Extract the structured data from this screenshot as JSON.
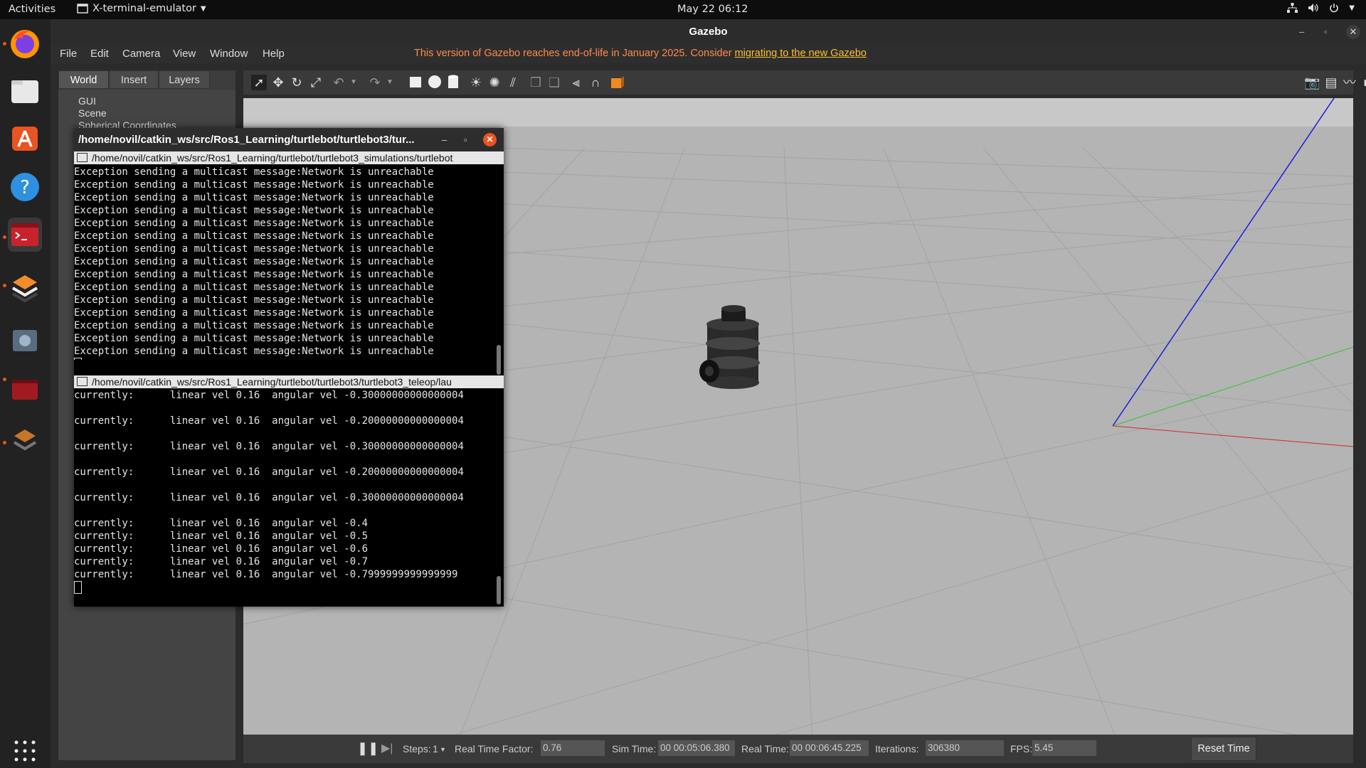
{
  "topbar": {
    "activities": "Activities",
    "app_name": "X-terminal-emulator",
    "clock": "May 22  06:12"
  },
  "dock": {
    "items": [
      "firefox-icon",
      "files-icon",
      "software-icon",
      "help-icon",
      "terminal-icon",
      "layers-icon",
      "grid-icon",
      "terminal-icon",
      "layers-icon"
    ],
    "show_apps": "apps-grid-icon"
  },
  "gazebo": {
    "title": "Gazebo",
    "menu": [
      "File",
      "Edit",
      "Camera",
      "View",
      "Window",
      "Help"
    ],
    "eol_text": "This version of Gazebo reaches end-of-life in January 2025. Consider ",
    "eol_link": "migrating to the new Gazebo",
    "tabs": [
      "World",
      "Insert",
      "Layers"
    ],
    "tree": [
      "GUI",
      "Scene",
      "Spherical Coordinates"
    ],
    "status": {
      "steps_label": "Steps:",
      "steps_value": "1",
      "rtf_label": "Real Time Factor:",
      "rtf_value": "0.76",
      "sim_label": "Sim Time:",
      "sim_value": "00 00:05:06.380",
      "real_label": "Real Time:",
      "real_value": "00 00:06:45.225",
      "iter_label": "Iterations:",
      "iter_value": "306380",
      "fps_label": "FPS:",
      "fps_value": "5.45",
      "reset_label": "Reset Time"
    }
  },
  "terminal": {
    "title": "/home/novil/catkin_ws/src/Ros1_Learning/turtlebot/turtlebot3/tur...",
    "pane1_path": "/home/novil/catkin_ws/src/Ros1_Learning/turtlebot/turtlebot3_simulations/turtlebot",
    "pane1_lines": [
      "Exception sending a multicast message:Network is unreachable",
      "Exception sending a multicast message:Network is unreachable",
      "Exception sending a multicast message:Network is unreachable",
      "Exception sending a multicast message:Network is unreachable",
      "Exception sending a multicast message:Network is unreachable",
      "Exception sending a multicast message:Network is unreachable",
      "Exception sending a multicast message:Network is unreachable",
      "Exception sending a multicast message:Network is unreachable",
      "Exception sending a multicast message:Network is unreachable",
      "Exception sending a multicast message:Network is unreachable",
      "Exception sending a multicast message:Network is unreachable",
      "Exception sending a multicast message:Network is unreachable",
      "Exception sending a multicast message:Network is unreachable",
      "Exception sending a multicast message:Network is unreachable",
      "Exception sending a multicast message:Network is unreachable"
    ],
    "pane2_path": "/home/novil/catkin_ws/src/Ros1_Learning/turtlebot/turtlebot3/turtlebot3_teleop/lau",
    "pane2_lines": [
      "currently:      linear vel 0.16  angular vel -0.30000000000000004",
      "",
      "currently:      linear vel 0.16  angular vel -0.20000000000000004",
      "",
      "currently:      linear vel 0.16  angular vel -0.30000000000000004",
      "",
      "currently:      linear vel 0.16  angular vel -0.20000000000000004",
      "",
      "currently:      linear vel 0.16  angular vel -0.30000000000000004",
      "",
      "currently:      linear vel 0.16  angular vel -0.4",
      "currently:      linear vel 0.16  angular vel -0.5",
      "currently:      linear vel 0.16  angular vel -0.6",
      "currently:      linear vel 0.16  angular vel -0.7",
      "currently:      linear vel 0.16  angular vel -0.7999999999999999"
    ]
  }
}
